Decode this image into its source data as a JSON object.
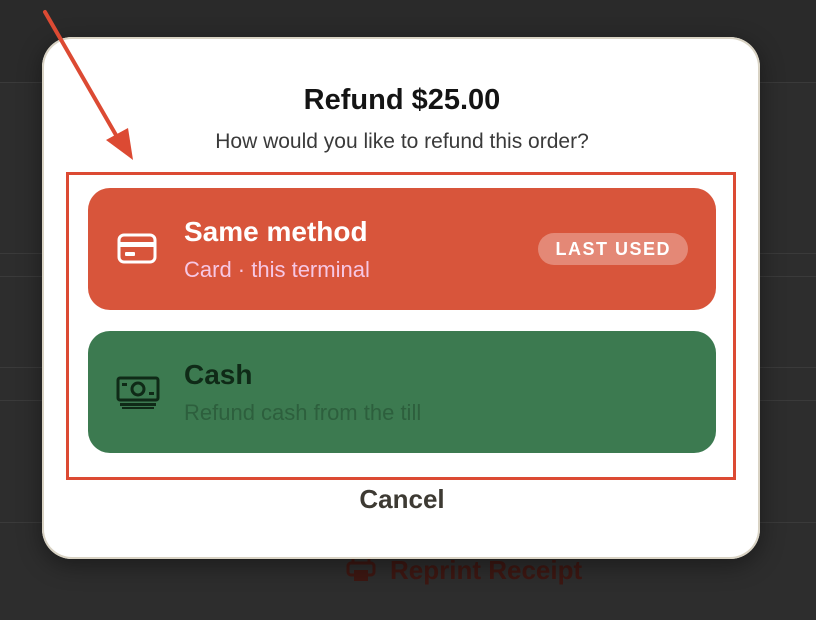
{
  "dialog": {
    "title": "Refund $25.00",
    "subtitle": "How would you like to refund this order?",
    "options": [
      {
        "title": "Same method",
        "subtitle": "Card · this terminal",
        "badge": "LAST USED",
        "icon": "credit-card-icon",
        "color": "#d8553b"
      },
      {
        "title": "Cash",
        "subtitle": "Refund cash from the till",
        "icon": "cash-icon",
        "color": "#3c7a50"
      }
    ],
    "cancel_label": "Cancel"
  },
  "background": {
    "reprint_label": "Reprint Receipt",
    "reprint_icon": "printer-icon"
  },
  "annotation": {
    "color": "#dc4a33"
  }
}
